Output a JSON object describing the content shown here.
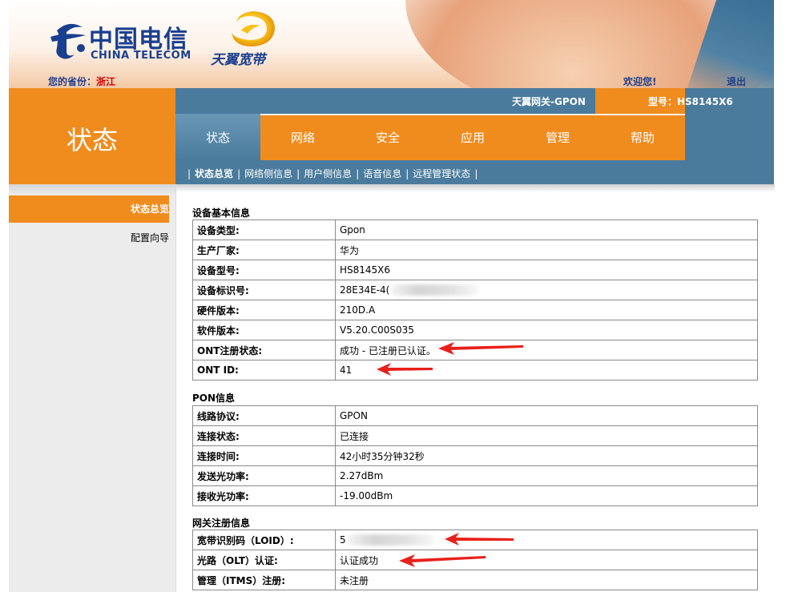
{
  "banner": {
    "brand_cn": "中国电信",
    "brand_en": "CHINA TELECOM",
    "sub_brand": "天翼宽带",
    "province_label": "您的省份：",
    "province_value": "浙江",
    "welcome": "欢迎您!",
    "logout": "退出"
  },
  "header": {
    "section_title": "状态",
    "gateway_name": "天翼网关-GPON",
    "model_label": "型号：HS8145X6"
  },
  "tabs": [
    {
      "label": "状态",
      "active": true
    },
    {
      "label": "网络"
    },
    {
      "label": "安全"
    },
    {
      "label": "应用"
    },
    {
      "label": "管理"
    },
    {
      "label": "帮助"
    }
  ],
  "subnav": [
    "状态总览",
    "网络侧信息",
    "用户侧信息",
    "语音信息",
    "远程管理状态"
  ],
  "sidebar": [
    "状态总览",
    "配置向导"
  ],
  "device_info": {
    "title": "设备基本信息",
    "rows": [
      {
        "k": "设备类型:",
        "v": "Gpon"
      },
      {
        "k": "生产厂家:",
        "v": "华为"
      },
      {
        "k": "设备型号:",
        "v": "HS8145X6"
      },
      {
        "k": "设备标识号:",
        "v": "28E34E-4("
      },
      {
        "k": "硬件版本:",
        "v": "210D.A"
      },
      {
        "k": "软件版本:",
        "v": "V5.20.C00S035"
      },
      {
        "k": "ONT注册状态:",
        "v": "成功 - 已注册已认证。"
      },
      {
        "k": "ONT ID:",
        "v": "41"
      }
    ]
  },
  "pon_info": {
    "title": "PON信息",
    "rows": [
      {
        "k": "线路协议:",
        "v": "GPON"
      },
      {
        "k": "连接状态:",
        "v": "已连接"
      },
      {
        "k": "连接时间:",
        "v": "42小时35分钟32秒"
      },
      {
        "k": "发送光功率:",
        "v": "2.27dBm"
      },
      {
        "k": "接收光功率:",
        "v": "-19.00dBm"
      }
    ]
  },
  "gateway_reg": {
    "title": "网关注册信息",
    "rows": [
      {
        "k": "宽带识别码（LOID）:",
        "v": "5"
      },
      {
        "k": "光路（OLT）认证:",
        "v": "认证成功"
      },
      {
        "k": "管理（ITMS）注册:",
        "v": "未注册"
      }
    ]
  },
  "colors": {
    "orange": "#f08c1e",
    "steel_blue": "#4a7b9c",
    "annotation_red": "#e8201a",
    "brand_blue": "#1a3f8f"
  }
}
